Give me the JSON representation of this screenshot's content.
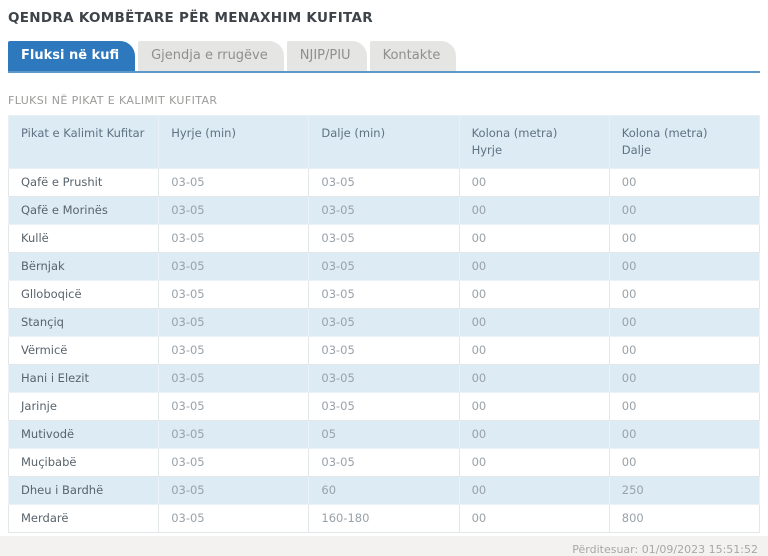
{
  "header": {
    "title": "QENDRA KOMBËTARE PËR MENAXHIM KUFITAR"
  },
  "tabs": [
    {
      "id": "fluksi-ne-kufi",
      "label": "Fluksi në kufi",
      "active": true
    },
    {
      "id": "gjendja-e-rrugeve",
      "label": "Gjendja e rrugëve",
      "active": false
    },
    {
      "id": "njip-piu",
      "label": "NJIP/PIU",
      "active": false
    },
    {
      "id": "kontakte",
      "label": "Kontakte",
      "active": false
    }
  ],
  "section": {
    "title": "FLUKSI NË PIKAT E KALIMIT KUFITAR"
  },
  "table": {
    "columns": [
      {
        "line1": "Pikat e Kalimit Kufitar",
        "line2": ""
      },
      {
        "line1": "Hyrje (min)",
        "line2": ""
      },
      {
        "line1": "Dalje (min)",
        "line2": ""
      },
      {
        "line1": "Kolona (metra)",
        "line2": "Hyrje"
      },
      {
        "line1": "Kolona (metra)",
        "line2": "Dalje"
      }
    ],
    "rows": [
      {
        "name": "Qafë e Prushit",
        "hyrje_min": "03-05",
        "dalje_min": "03-05",
        "kolona_hyrje": "00",
        "kolona_dalje": "00"
      },
      {
        "name": "Qafë e Morinës",
        "hyrje_min": "03-05",
        "dalje_min": "03-05",
        "kolona_hyrje": "00",
        "kolona_dalje": "00"
      },
      {
        "name": "Kullë",
        "hyrje_min": "03-05",
        "dalje_min": "03-05",
        "kolona_hyrje": "00",
        "kolona_dalje": "00"
      },
      {
        "name": "Bërnjak",
        "hyrje_min": "03-05",
        "dalje_min": "03-05",
        "kolona_hyrje": "00",
        "kolona_dalje": "00"
      },
      {
        "name": "Glloboqicë",
        "hyrje_min": "03-05",
        "dalje_min": "03-05",
        "kolona_hyrje": "00",
        "kolona_dalje": "00"
      },
      {
        "name": "Stançiq",
        "hyrje_min": "03-05",
        "dalje_min": "03-05",
        "kolona_hyrje": "00",
        "kolona_dalje": "00"
      },
      {
        "name": "Vërmicë",
        "hyrje_min": "03-05",
        "dalje_min": "03-05",
        "kolona_hyrje": "00",
        "kolona_dalje": "00"
      },
      {
        "name": "Hani i Elezit",
        "hyrje_min": "03-05",
        "dalje_min": "03-05",
        "kolona_hyrje": "00",
        "kolona_dalje": "00"
      },
      {
        "name": "Jarinje",
        "hyrje_min": "03-05",
        "dalje_min": "03-05",
        "kolona_hyrje": "00",
        "kolona_dalje": "00"
      },
      {
        "name": "Mutivodë",
        "hyrje_min": "03-05",
        "dalje_min": "05",
        "kolona_hyrje": "00",
        "kolona_dalje": "00"
      },
      {
        "name": "Muçibabë",
        "hyrje_min": "03-05",
        "dalje_min": "03-05",
        "kolona_hyrje": "00",
        "kolona_dalje": "00"
      },
      {
        "name": "Dheu i Bardhë",
        "hyrje_min": "03-05",
        "dalje_min": "60",
        "kolona_hyrje": "00",
        "kolona_dalje": "250"
      },
      {
        "name": "Merdarë",
        "hyrje_min": "03-05",
        "dalje_min": "160-180",
        "kolona_hyrje": "00",
        "kolona_dalje": "800"
      }
    ]
  },
  "footer": {
    "updated": "Përditesuar: 01/09/2023 15:51:52"
  },
  "colors": {
    "active_tab": "#2e78be",
    "tab_underline": "#5b97c9",
    "inactive_tab_bg": "#e5e5e4",
    "table_header_bg": "#dcebf4",
    "row_alt_bg": "#dcebf4",
    "footer_bg": "#f4f2f0",
    "title_text": "#3d4349"
  }
}
